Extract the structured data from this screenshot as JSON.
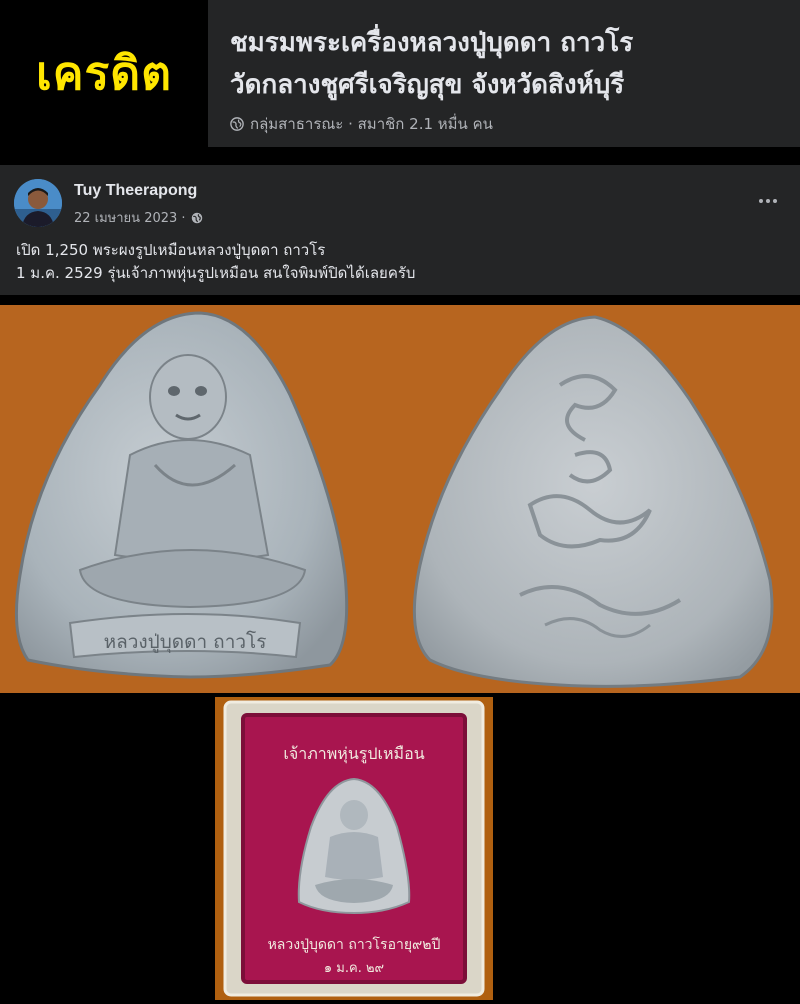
{
  "banner": {
    "credit_label": "เครดิต",
    "group_name_line1": "ชมรมพระเครื่องหลวงปู่บุดดา ถาวโร",
    "group_name_line2": "วัดกลางชูศรีเจริญสุข จังหวัดสิงห์บุรี",
    "group_meta": "กลุ่มสาธารณะ · สมาชิก 2.1 หมื่น คน"
  },
  "post": {
    "author": "Tuy Theerapong",
    "date": "22 เมษายน 2023 ·",
    "text_line1": "เปิด 1,250  พระผงรูปเหมือนหลวงปู่บุดดา ถาวโร",
    "text_line2": "1 ม.ค. 2529 รุ่นเจ้าภาพหุ่นรูปเหมือน สนใจพิมพ์ปิดได้เลยครับ"
  },
  "photos": {
    "front_inscription": "หลวงปู่บุดดา ถาวโร",
    "box_top_text": "เจ้าภาพหุ่นรูปเหมือน",
    "box_bottom_text": "หลวงปู่บุดดา ถาวโรอายุ๙๒ปี",
    "box_date_text": "๑ ม.ค. ๒๙"
  },
  "colors": {
    "yellow_credit": "#ffe600",
    "facebook_dark_card": "#242526",
    "photo_background": "#b7651f",
    "box_velvet": "#a8154f"
  }
}
